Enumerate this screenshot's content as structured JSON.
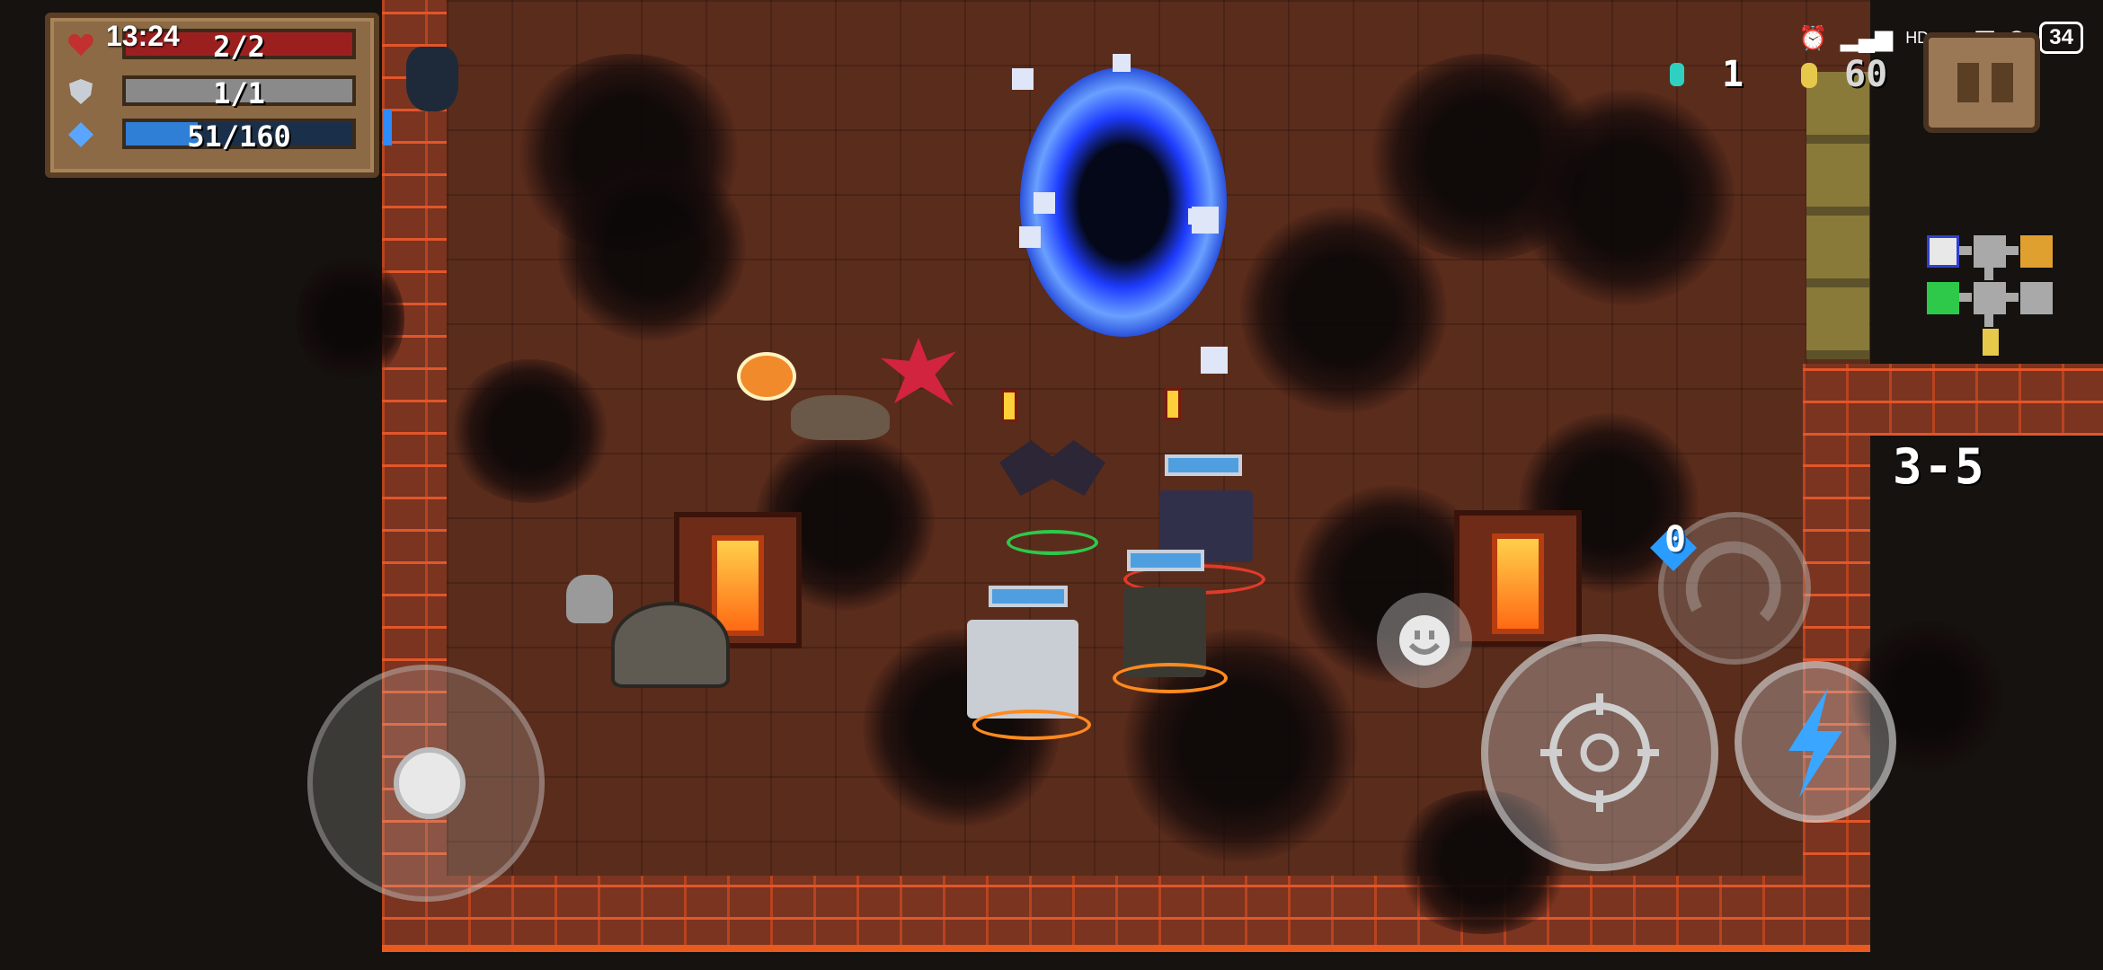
{
  "system": {
    "clock": "13:24",
    "network_label": "HD",
    "battery": "34"
  },
  "hud": {
    "health": {
      "current": 2,
      "max": 2,
      "fraction": 1.0,
      "color": "#9c1f1f"
    },
    "armor": {
      "text": "1/1",
      "current": 1,
      "max": 1,
      "fraction": 1.0,
      "color": "#8a8a8a"
    },
    "energy": {
      "text": "51/160",
      "current": 51,
      "max": 160,
      "fraction": 0.319,
      "color": "#2f7fd6"
    }
  },
  "currency": {
    "gems": "1",
    "coins": "60",
    "gem_color": "#2fd0c0",
    "coin_color": "#e6c84a"
  },
  "level": {
    "label": "3-5"
  },
  "weapon": {
    "ammo_cost": "0"
  },
  "colors": {
    "floor": "#5a2c1c",
    "wall_brick": "#e2562a",
    "portal": "#3a66ff",
    "player_ring": "#ff8a1e"
  },
  "icons": {
    "health": "heart-icon",
    "armor": "shield-icon",
    "energy": "diamond-icon",
    "pause": "pause-icon",
    "emote": "smiley-icon",
    "fire": "crosshair-icon",
    "skill": "lightning-icon",
    "swap": "swap-weapon-icon"
  }
}
